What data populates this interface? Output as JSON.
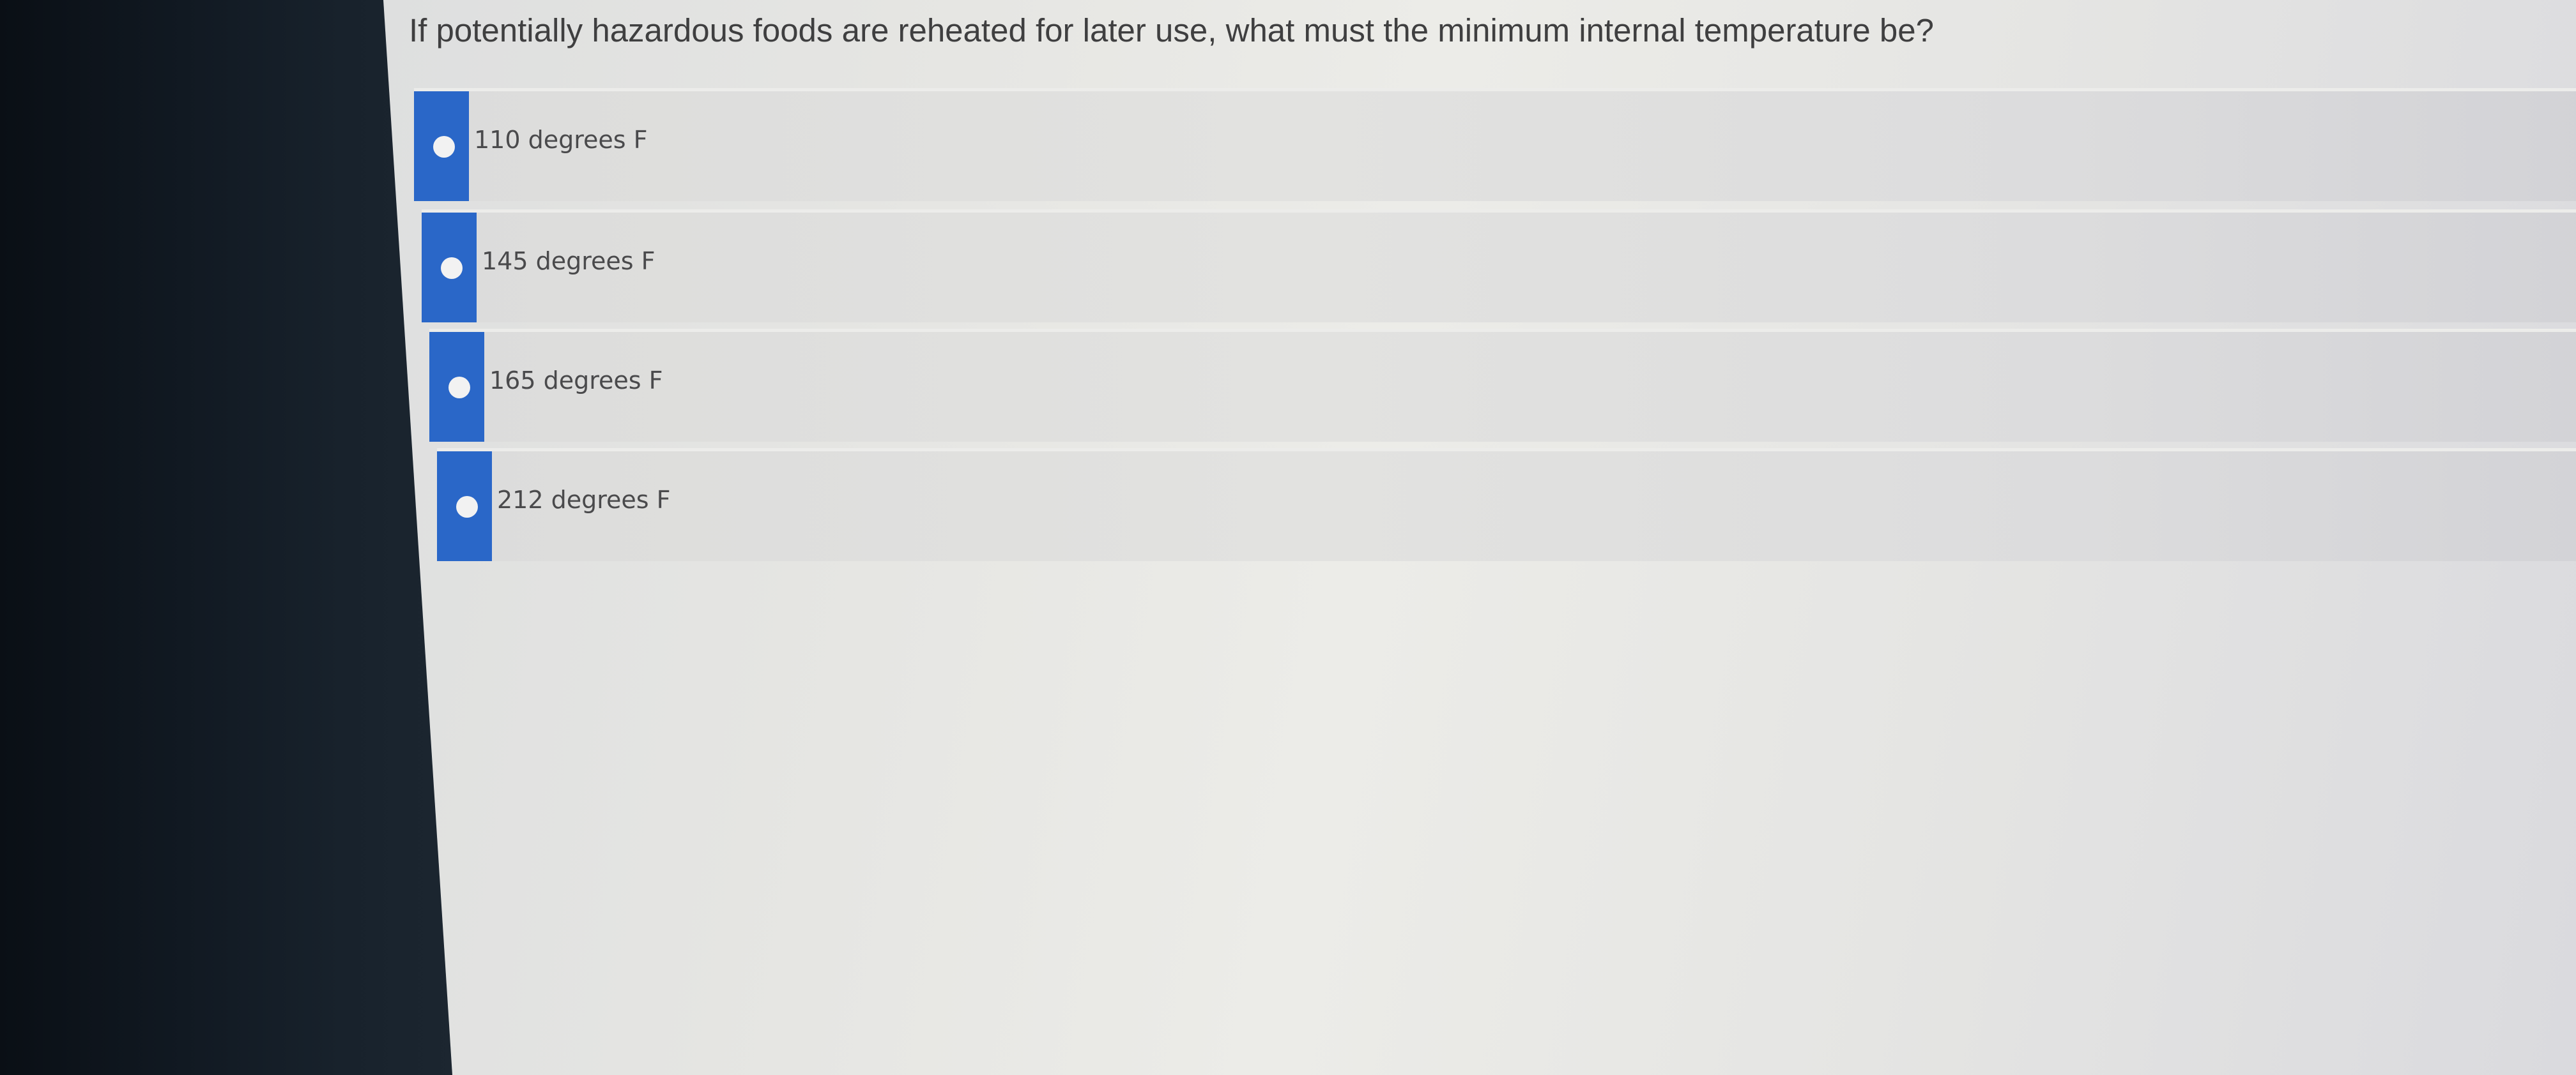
{
  "quiz": {
    "question": "If potentially hazardous foods are reheated for later use, what must the minimum internal temperature be?",
    "options": [
      {
        "label": "110 degrees F"
      },
      {
        "label": "145 degrees F"
      },
      {
        "label": "165 degrees F"
      },
      {
        "label": "212 degrees F"
      }
    ]
  },
  "colors": {
    "accent": "#2a67c8"
  }
}
